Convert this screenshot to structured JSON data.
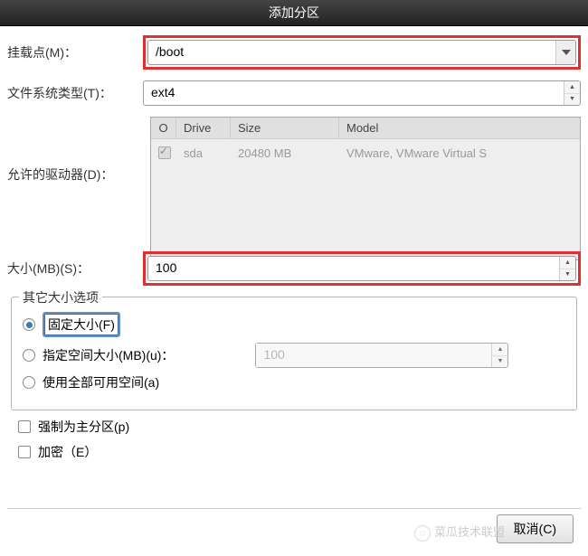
{
  "titlebar": {
    "title": "添加分区"
  },
  "form": {
    "mount_point_label": "挂载点(M)：",
    "mount_point_value": "/boot",
    "fs_type_label": "文件系统类型(T)：",
    "fs_type_value": "ext4",
    "allowed_drives_label": "允许的驱动器(D)：",
    "size_label": "大小(MB)(S)：",
    "size_value": "100"
  },
  "drives": {
    "headers": {
      "check": "O",
      "drive": "Drive",
      "size": "Size",
      "model": "Model"
    },
    "row": {
      "drive": "sda",
      "size": "20480 MB",
      "model": "VMware, VMware Virtual S"
    }
  },
  "size_options": {
    "legend": "其它大小选项",
    "fixed_label": "固定大小(F)",
    "fill_to_label": "指定空间大小(MB)(u)：",
    "fill_to_value": "100",
    "fill_all_label": "使用全部可用空间(a)",
    "selected": "fixed"
  },
  "checkboxes": {
    "force_primary": "强制为主分区(p)",
    "encrypt": "加密（E）"
  },
  "buttons": {
    "cancel": "取消(C)"
  },
  "watermark": {
    "text": "菜瓜技术联盟"
  }
}
